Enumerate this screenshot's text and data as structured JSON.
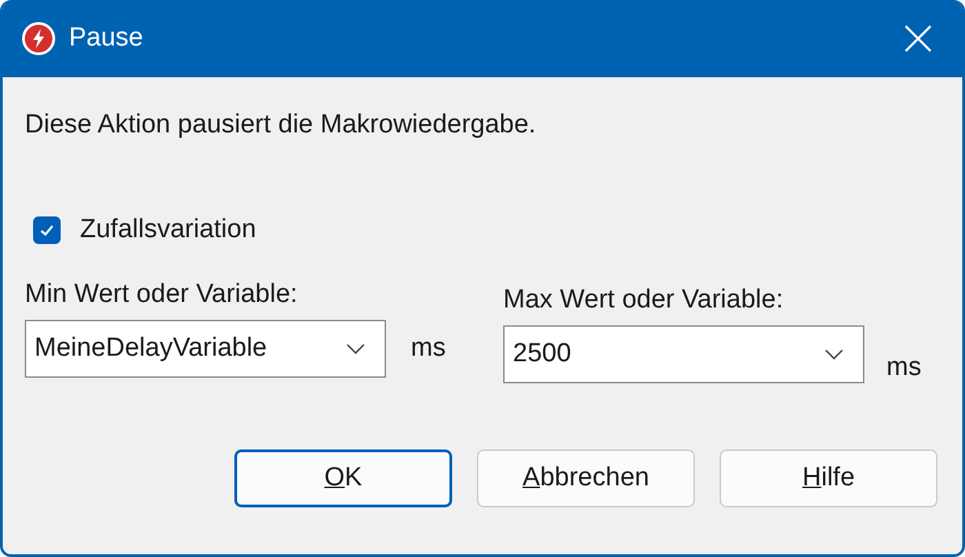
{
  "window": {
    "title": "Pause"
  },
  "description": "Diese Aktion pausiert die Makrowiedergabe.",
  "random_variation": {
    "label": "Zufallsvariation",
    "checked": true
  },
  "fields": [
    {
      "label": "Min Wert oder Variable:",
      "value": "MeineDelayVariable",
      "unit": "ms"
    },
    {
      "label": "Max Wert oder Variable:",
      "value": "2500",
      "unit": "ms"
    }
  ],
  "buttons": [
    {
      "mnemonic": "O",
      "rest": "K",
      "default": true
    },
    {
      "mnemonic": "A",
      "rest": "bbrechen",
      "default": false
    },
    {
      "mnemonic": "H",
      "rest": "ilfe",
      "default": false
    }
  ]
}
